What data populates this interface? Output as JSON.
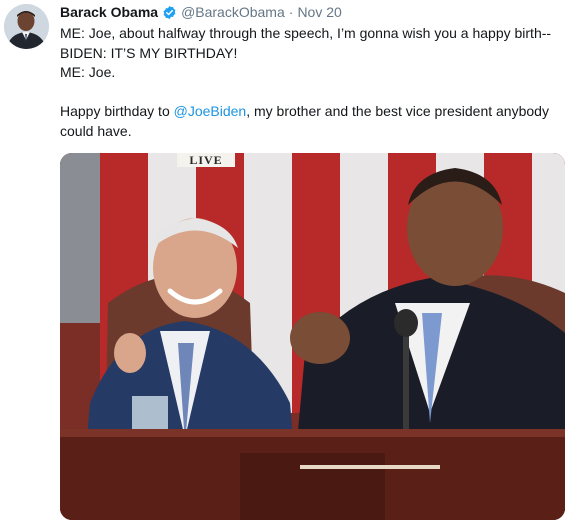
{
  "tweet": {
    "author_name": "Barack Obama",
    "handle": "@BarackObama",
    "separator": "·",
    "timestamp": "Nov 20",
    "verified_icon": "verified-badge-icon",
    "lines": [
      "ME:  Joe, about halfway through the speech, I’m gonna wish you a happy birth--",
      "BIDEN:  IT’S MY BIRTHDAY!",
      "ME:  Joe."
    ],
    "closing_prefix": "Happy birthday to ",
    "mention": "@JoeBiden",
    "closing_suffix": ", my brother and the best vice president anybody could have.",
    "media": {
      "banner_text": "LIVE"
    }
  },
  "colors": {
    "link": "#1b95e0",
    "secondary_text": "#657786",
    "primary_text": "#14171a",
    "verified": "#1da1f2"
  }
}
